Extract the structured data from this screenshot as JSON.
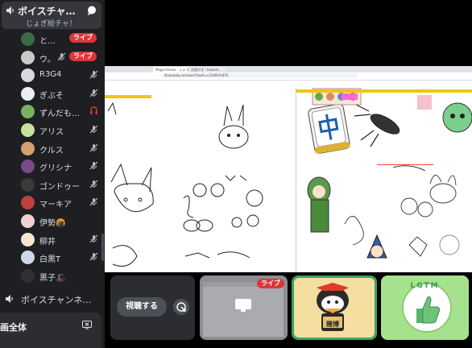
{
  "voice_channel": {
    "title": "ボイスチャ…",
    "subtitle": "じょぎ絵チャ！"
  },
  "users": [
    {
      "name": "と…",
      "live": true,
      "muted": false
    },
    {
      "name": "ウ。",
      "live": true,
      "muted": true
    },
    {
      "name": "R3G4",
      "live": false,
      "muted": true
    },
    {
      "name": "ぎぶそ",
      "live": false,
      "muted": true
    },
    {
      "name": "ずんだも…",
      "live": false,
      "muted": false,
      "deafened": true
    },
    {
      "name": "アリス",
      "live": false,
      "muted": true
    },
    {
      "name": "クルス",
      "live": false,
      "muted": true
    },
    {
      "name": "グリシナ",
      "live": false,
      "muted": true
    },
    {
      "name": "ゴンドゥー",
      "live": false,
      "muted": true
    },
    {
      "name": "マーキア",
      "live": false,
      "muted": true
    },
    {
      "name": "伊勢🍘",
      "live": false,
      "muted": false
    },
    {
      "name": "柳井",
      "live": false,
      "muted": true
    },
    {
      "name": "白黒T",
      "live": false,
      "muted": true
    },
    {
      "name": "黒子🎩",
      "live": false,
      "muted": false
    }
  ],
  "live_label": "ライブ",
  "voice_channel_2": {
    "name": "ボイスチャンネ…"
  },
  "bottom_panel": {
    "label": "画全体"
  },
  "stream": {
    "address": "draw.kuku.lu/room/?hash=c31d9cfc876",
    "tabs": [
      "Whiteboard",
      "Magic/drawa - ふぉ 落書きサ…",
      "お絵かき - hasami…"
    ]
  },
  "controls": {
    "watch_label": "視聴する"
  },
  "tiles": {
    "stream_live": "ライブ",
    "tako_label": "賭博",
    "lgtm_label": "LGTM"
  },
  "colors": {
    "sidebar_bg": "#1e1f22",
    "live_red": "#da373c",
    "speaking_green": "#3ba55d",
    "lgtm_green": "#a6e28e"
  }
}
